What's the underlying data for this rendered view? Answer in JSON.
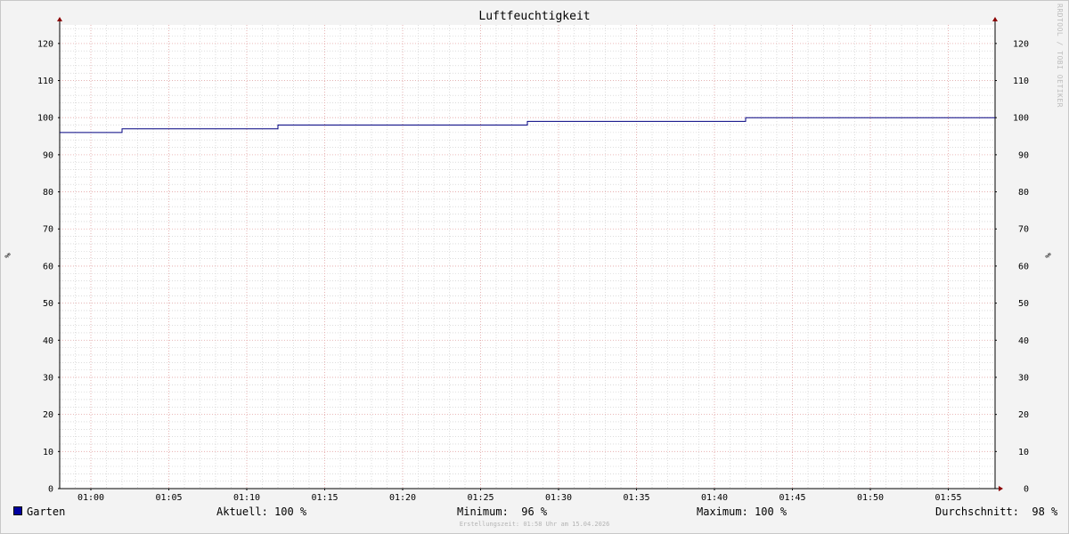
{
  "title": "Luftfeuchtigkeit",
  "watermark": "RRDTOOL / TOBI OETIKER",
  "unit": "%",
  "legend": {
    "series_name": "Garten",
    "current": "Aktuell: 100 %",
    "minimum": "Minimum:  96 %",
    "maximum": "Maximum: 100 %",
    "average": "Durchschnitt:  98 %"
  },
  "footer": "Erstellungszeit: 01:58 Uhr am 15.04.2026",
  "colors": {
    "line": "#000080",
    "major_grid": "#e8a8a8",
    "minor_grid": "#c8c8c8",
    "axis_arrow": "#8b0000",
    "swatch": "#0000a0"
  },
  "chart_data": {
    "type": "line",
    "x_ticks": [
      "01:00",
      "01:05",
      "01:10",
      "01:15",
      "01:20",
      "01:25",
      "01:30",
      "01:35",
      "01:40",
      "01:45",
      "01:50",
      "01:55"
    ],
    "y_ticks": [
      0,
      10,
      20,
      30,
      40,
      50,
      60,
      70,
      80,
      90,
      100,
      110,
      120
    ],
    "ylim": [
      0,
      125
    ],
    "xlim": [
      "00:58",
      "01:58"
    ],
    "series": [
      {
        "name": "Garten",
        "step": true,
        "points": [
          {
            "x": "00:58",
            "y": 96
          },
          {
            "x": "01:02",
            "y": 97
          },
          {
            "x": "01:12",
            "y": 98
          },
          {
            "x": "01:28",
            "y": 99
          },
          {
            "x": "01:42",
            "y": 100
          },
          {
            "x": "01:58",
            "y": 100
          }
        ]
      }
    ],
    "grid": true
  }
}
